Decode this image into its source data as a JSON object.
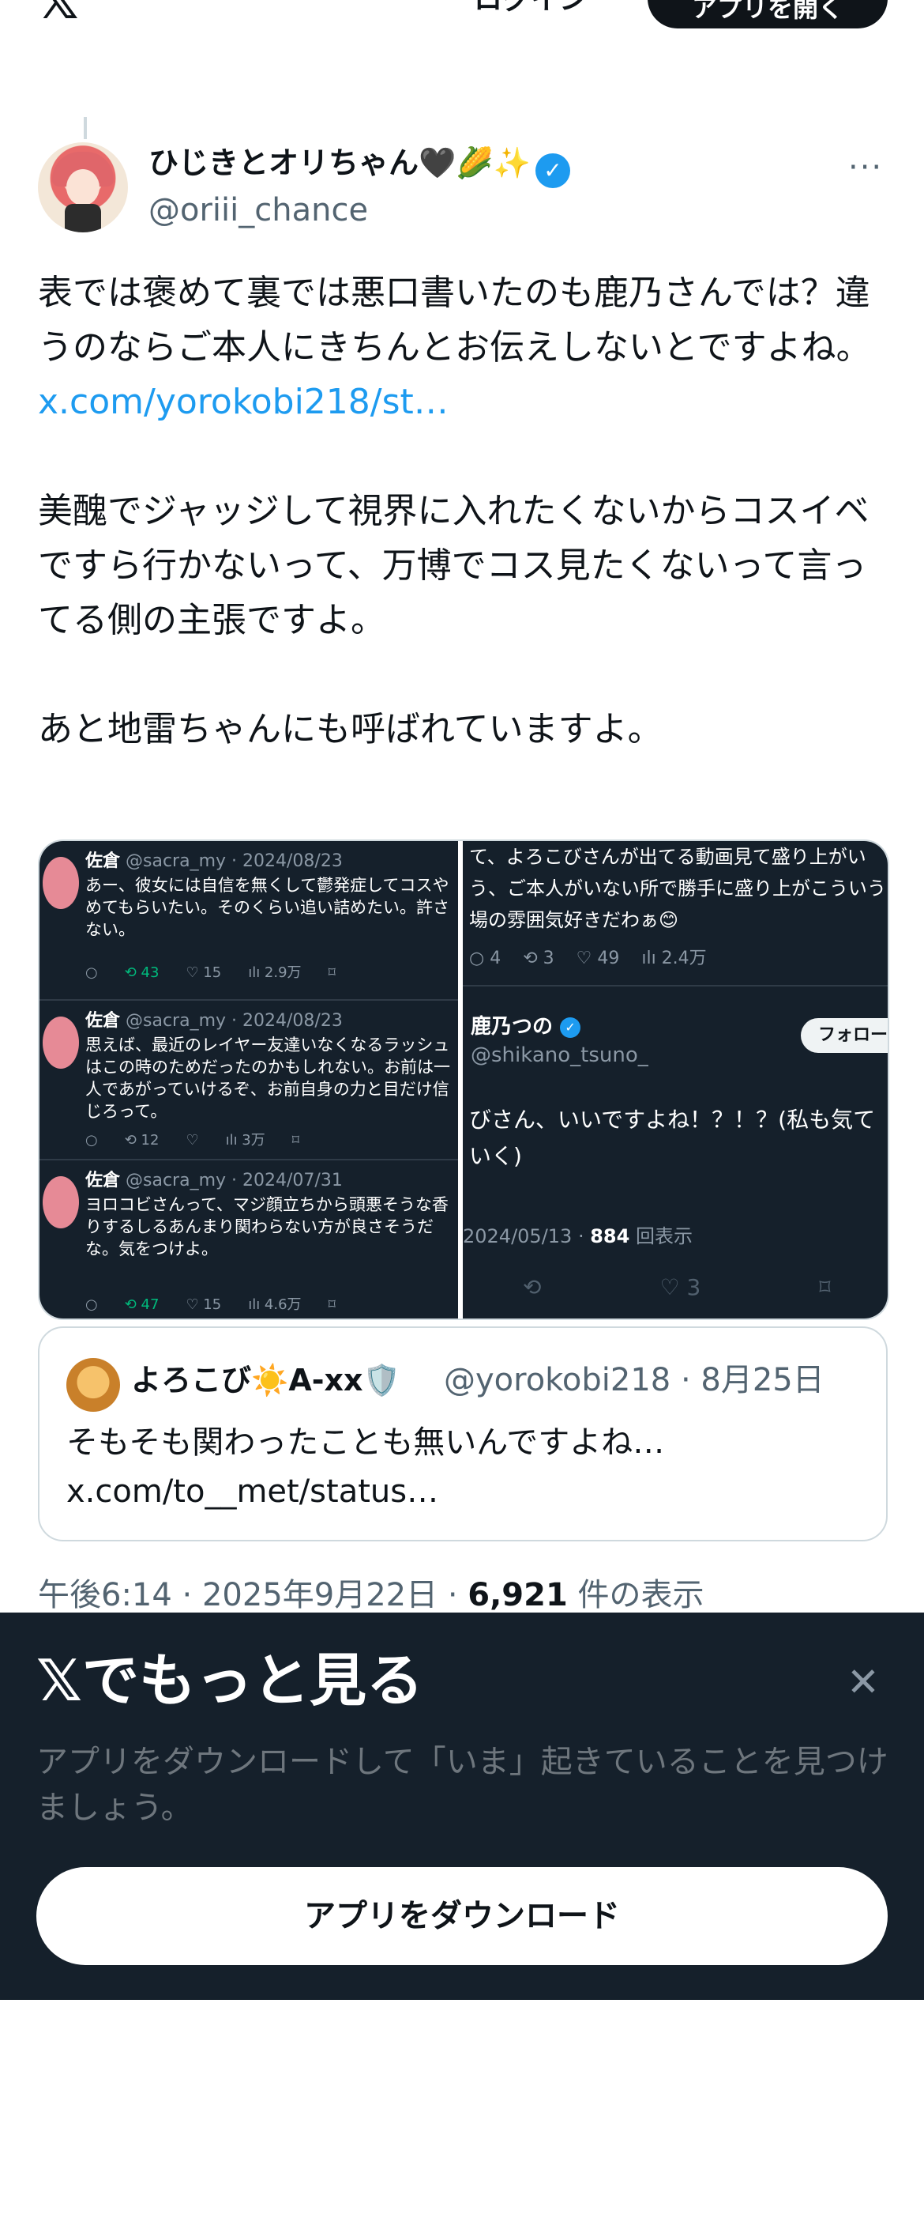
{
  "topbar": {
    "logo": "𝕏",
    "login": "ログイン",
    "open_app": "アプリを開く"
  },
  "author": {
    "name": "ひじきとオリちゃん",
    "emojis": "🖤🌽✨",
    "verified_glyph": "✓",
    "handle": "@oriii_chance",
    "more_glyph": "···"
  },
  "tweet": {
    "para1": "表では褒めて裏では悪口書いたのも鹿乃さんでは？違うのならご本人にきちんとお伝えしないとですよね。",
    "link": "x.com/yorokobi218/st…",
    "para2": "美醜でジャッジして視界に入れたくないからコスイベですら行かないって、万博でコス見たくないって言ってる側の主張ですよ。",
    "para3": "あと地雷ちゃんにも呼ばれていますよ。"
  },
  "media": {
    "left_posts": [
      {
        "name": "佐倉",
        "meta": "@sacra_my · 2024/08/23",
        "text": "あー、彼女には自信を無くして鬱発症してコスやめてもらいたい。そのくらい追い詰めたい。許さない。",
        "reply": "○",
        "rt": "⟲ 43",
        "like": "♡ 15",
        "views": "ılı 2.9万",
        "bm": "⌑"
      },
      {
        "name": "佐倉",
        "meta": "@sacra_my · 2024/08/23",
        "text": "思えば、最近のレイヤー友達いなくなるラッシュはこの時のためだったのかもしれない。お前は一人であがっていけるぞ、お前自身の力と目だけ信じろって。",
        "reply": "○",
        "rt": "⟲ 12",
        "like": "♡",
        "views": "ılı 3万",
        "bm": "⌑"
      },
      {
        "name": "佐倉",
        "meta": "@sacra_my · 2024/07/31",
        "text": "ヨロコビさんって、マジ顔立ちから頭悪そうな香りするしるあんまり関わらない方が良さそうだな。気をつけよ。",
        "reply": "○",
        "rt": "⟲ 47",
        "like": "♡ 15",
        "views": "ılı 4.6万",
        "bm": "⌑"
      }
    ],
    "right": {
      "top_text": "て、よろこびさんが出てる動画見て盛り上がいう、ご本人がいない所で勝手に盛り上がこういう場の雰囲気好きだわぁ😊",
      "reply": "○ 4",
      "rt": "⟲ 3",
      "like": "♡ 49",
      "views": "ılı 2.4万",
      "name": "鹿乃つの",
      "verified_glyph": "✓",
      "handle": "@shikano_tsuno_",
      "follow": "フォロー",
      "text": "びさん、いいですよね！？！？(私も気ていく)",
      "date": "2024/05/13 · ",
      "views_count": "884",
      "views_label": "回表示",
      "bot_rt": "⟲",
      "bot_like": "♡ 3",
      "bot_bm": "⌑"
    }
  },
  "quote": {
    "name": "よろこび☀️A-xx🛡️",
    "handle": "@yorokobi218 · 8月25日",
    "text": "そもそも関わったことも無いんですよね…\nx.com/to__met/status…"
  },
  "meta": {
    "time": "午後6:14 · 2025年9月22日 · ",
    "views": "6,921",
    "views_label": " 件の表示"
  },
  "banner": {
    "title": "𝕏でもっと見る",
    "close_glyph": "✕",
    "subtitle": "アプリをダウンロードして「いま」起きていることを見つけましょう。",
    "button": "アプリをダウンロード"
  }
}
